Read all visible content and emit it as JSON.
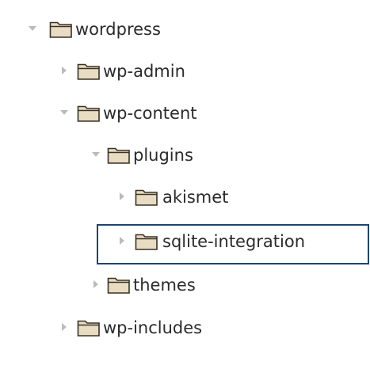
{
  "tree": {
    "nodes": [
      {
        "label": "wordpress",
        "expanded": true,
        "selected": false
      },
      {
        "label": "wp-admin",
        "expanded": false,
        "selected": false
      },
      {
        "label": "wp-content",
        "expanded": true,
        "selected": false
      },
      {
        "label": "plugins",
        "expanded": true,
        "selected": false
      },
      {
        "label": "akismet",
        "expanded": false,
        "selected": false
      },
      {
        "label": "sqlite-integration",
        "expanded": false,
        "selected": true
      },
      {
        "label": "themes",
        "expanded": false,
        "selected": false
      },
      {
        "label": "wp-includes",
        "expanded": false,
        "selected": false
      }
    ]
  },
  "colors": {
    "text": "#2b2b2b",
    "arrow": "#bbbbbb",
    "focus_border": "#1d4471",
    "folder_fill": "#e8dcc3",
    "folder_stroke": "#3a3226"
  },
  "icons": {
    "expanded": "chevron-down-icon",
    "collapsed": "chevron-right-icon",
    "folder": "folder-icon"
  }
}
